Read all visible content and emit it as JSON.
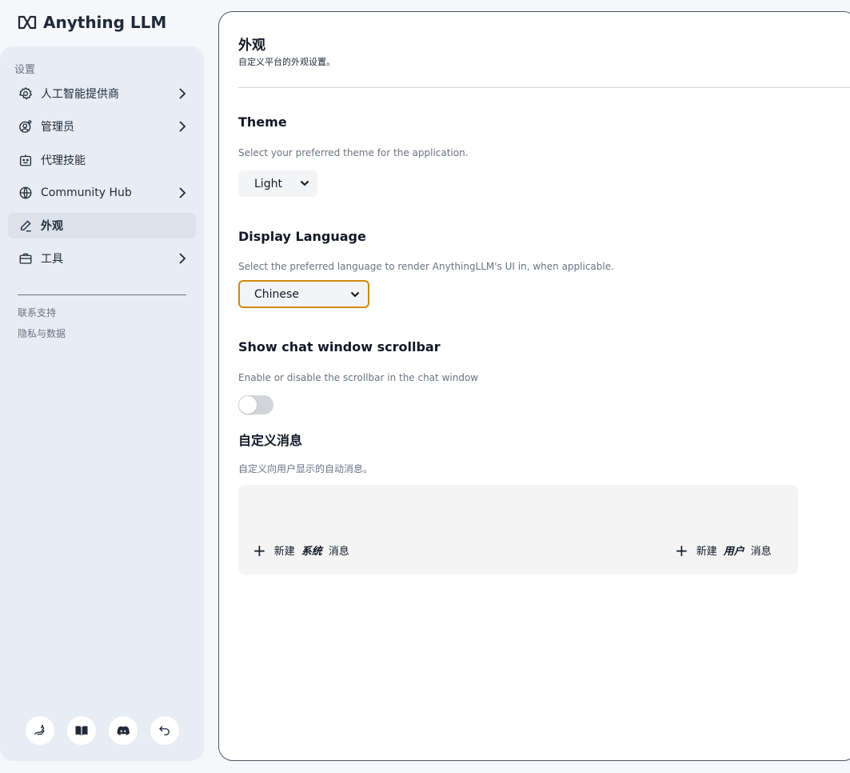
{
  "app": {
    "logo_text": "Anything LLM"
  },
  "sidebar": {
    "section_label": "设置",
    "items": [
      {
        "label": "人工智能提供商",
        "icon": "gear-icon",
        "has_chevron": true
      },
      {
        "label": "管理员",
        "icon": "user-gear-icon",
        "has_chevron": true
      },
      {
        "label": "代理技能",
        "icon": "robot-icon",
        "has_chevron": false
      },
      {
        "label": "Community Hub",
        "icon": "globe-icon",
        "has_chevron": true
      },
      {
        "label": "外观",
        "icon": "pencil-icon",
        "has_chevron": false,
        "active": true
      },
      {
        "label": "工具",
        "icon": "briefcase-icon",
        "has_chevron": true
      }
    ],
    "links": [
      "联系支持",
      "隐私与数据"
    ],
    "footer_icons": [
      "hand-help-icon",
      "book-icon",
      "discord-icon",
      "back-arrow-icon"
    ]
  },
  "main": {
    "title": "外观",
    "subtitle": "自定义平台的外观设置。",
    "theme": {
      "title": "Theme",
      "description": "Select your preferred theme for the application.",
      "value": "Light"
    },
    "language": {
      "title": "Display Language",
      "description": "Select the preferred language to render AnythingLLM's UI in, when applicable.",
      "value": "Chinese"
    },
    "scrollbar": {
      "title": "Show chat window scrollbar",
      "description": "Enable or disable the scrollbar in the chat window",
      "enabled": false
    },
    "custom_messages": {
      "title": "自定义消息",
      "description": "自定义向用户显示的自动消息。",
      "new_system": {
        "prefix": "新建",
        "emph": "系统",
        "suffix": "消息"
      },
      "new_user": {
        "prefix": "新建",
        "emph": "用户",
        "suffix": "消息"
      }
    }
  },
  "colors": {
    "accent_focus": "#d08a0f",
    "sidebar_bg": "#e7edf5",
    "active_item_bg": "#dbe2ec"
  }
}
